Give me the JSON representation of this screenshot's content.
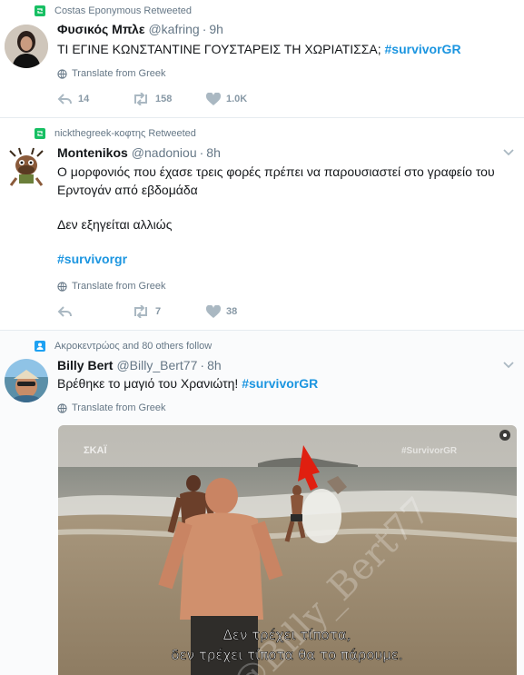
{
  "colors": {
    "retweet_green": "#17bf63",
    "link_blue": "#1b95e0",
    "muted": "#657786",
    "icon_gray": "#8899a6"
  },
  "tweets": [
    {
      "context_icon": "retweet-icon",
      "context_text": "Costas Eponymous Retweeted",
      "name": "Φυσικός Μπλε",
      "handle": "@kafring",
      "dot": "·",
      "time": "9h",
      "text": "ΤΙ ΕΓΙΝΕ ΚΩΝΣΤΑΝΤΙΝΕ ΓΟΥΣΤΑΡΕΙΣ ΤΗ ΧΩΡΙΑΤΙΣΣΑ;",
      "hashtag": "#survivorGR",
      "translate": "Translate from Greek",
      "reply_count": "14",
      "retweet_count": "158",
      "like_count": "1.0K"
    },
    {
      "context_icon": "retweet-icon",
      "context_text": "nickthegreek-κοφτης Retweeted",
      "name": "Montenikos",
      "handle": "@nadoniou",
      "dot": "·",
      "time": "8h",
      "text_line1": "Ο μορφονιός που έχασε τρεις φορές πρέπει να παρουσιαστεί στο γραφείο του",
      "text_line2": "Ερντογάν από εβδομάδα",
      "text_line3": "Δεν εξηγείται αλλιώς",
      "hashtag": "#survivorgr",
      "translate": "Translate from Greek",
      "reply_count": "",
      "retweet_count": "7",
      "like_count": "38"
    },
    {
      "context_icon": "person-follow-icon",
      "context_text": "Ακροκεντρώος and 80 others follow",
      "name": "Billy Bert",
      "handle": "@Billy_Bert77",
      "dot": "·",
      "time": "8h",
      "text": "Βρέθηκε το μαγιό του Χρανιώτη!",
      "hashtag": "#survivorGR",
      "translate": "Translate from Greek",
      "media": {
        "channel_logo": "ΣΚΑΪ",
        "watermark_tag": "#SurvivorGR",
        "watermark": "@Billy_Bert77",
        "subtitle_line1": "Δεν τρέχει τίποτα,",
        "subtitle_line2": "δεν τρέχει τίποτα θα το πάρουμε."
      }
    }
  ]
}
